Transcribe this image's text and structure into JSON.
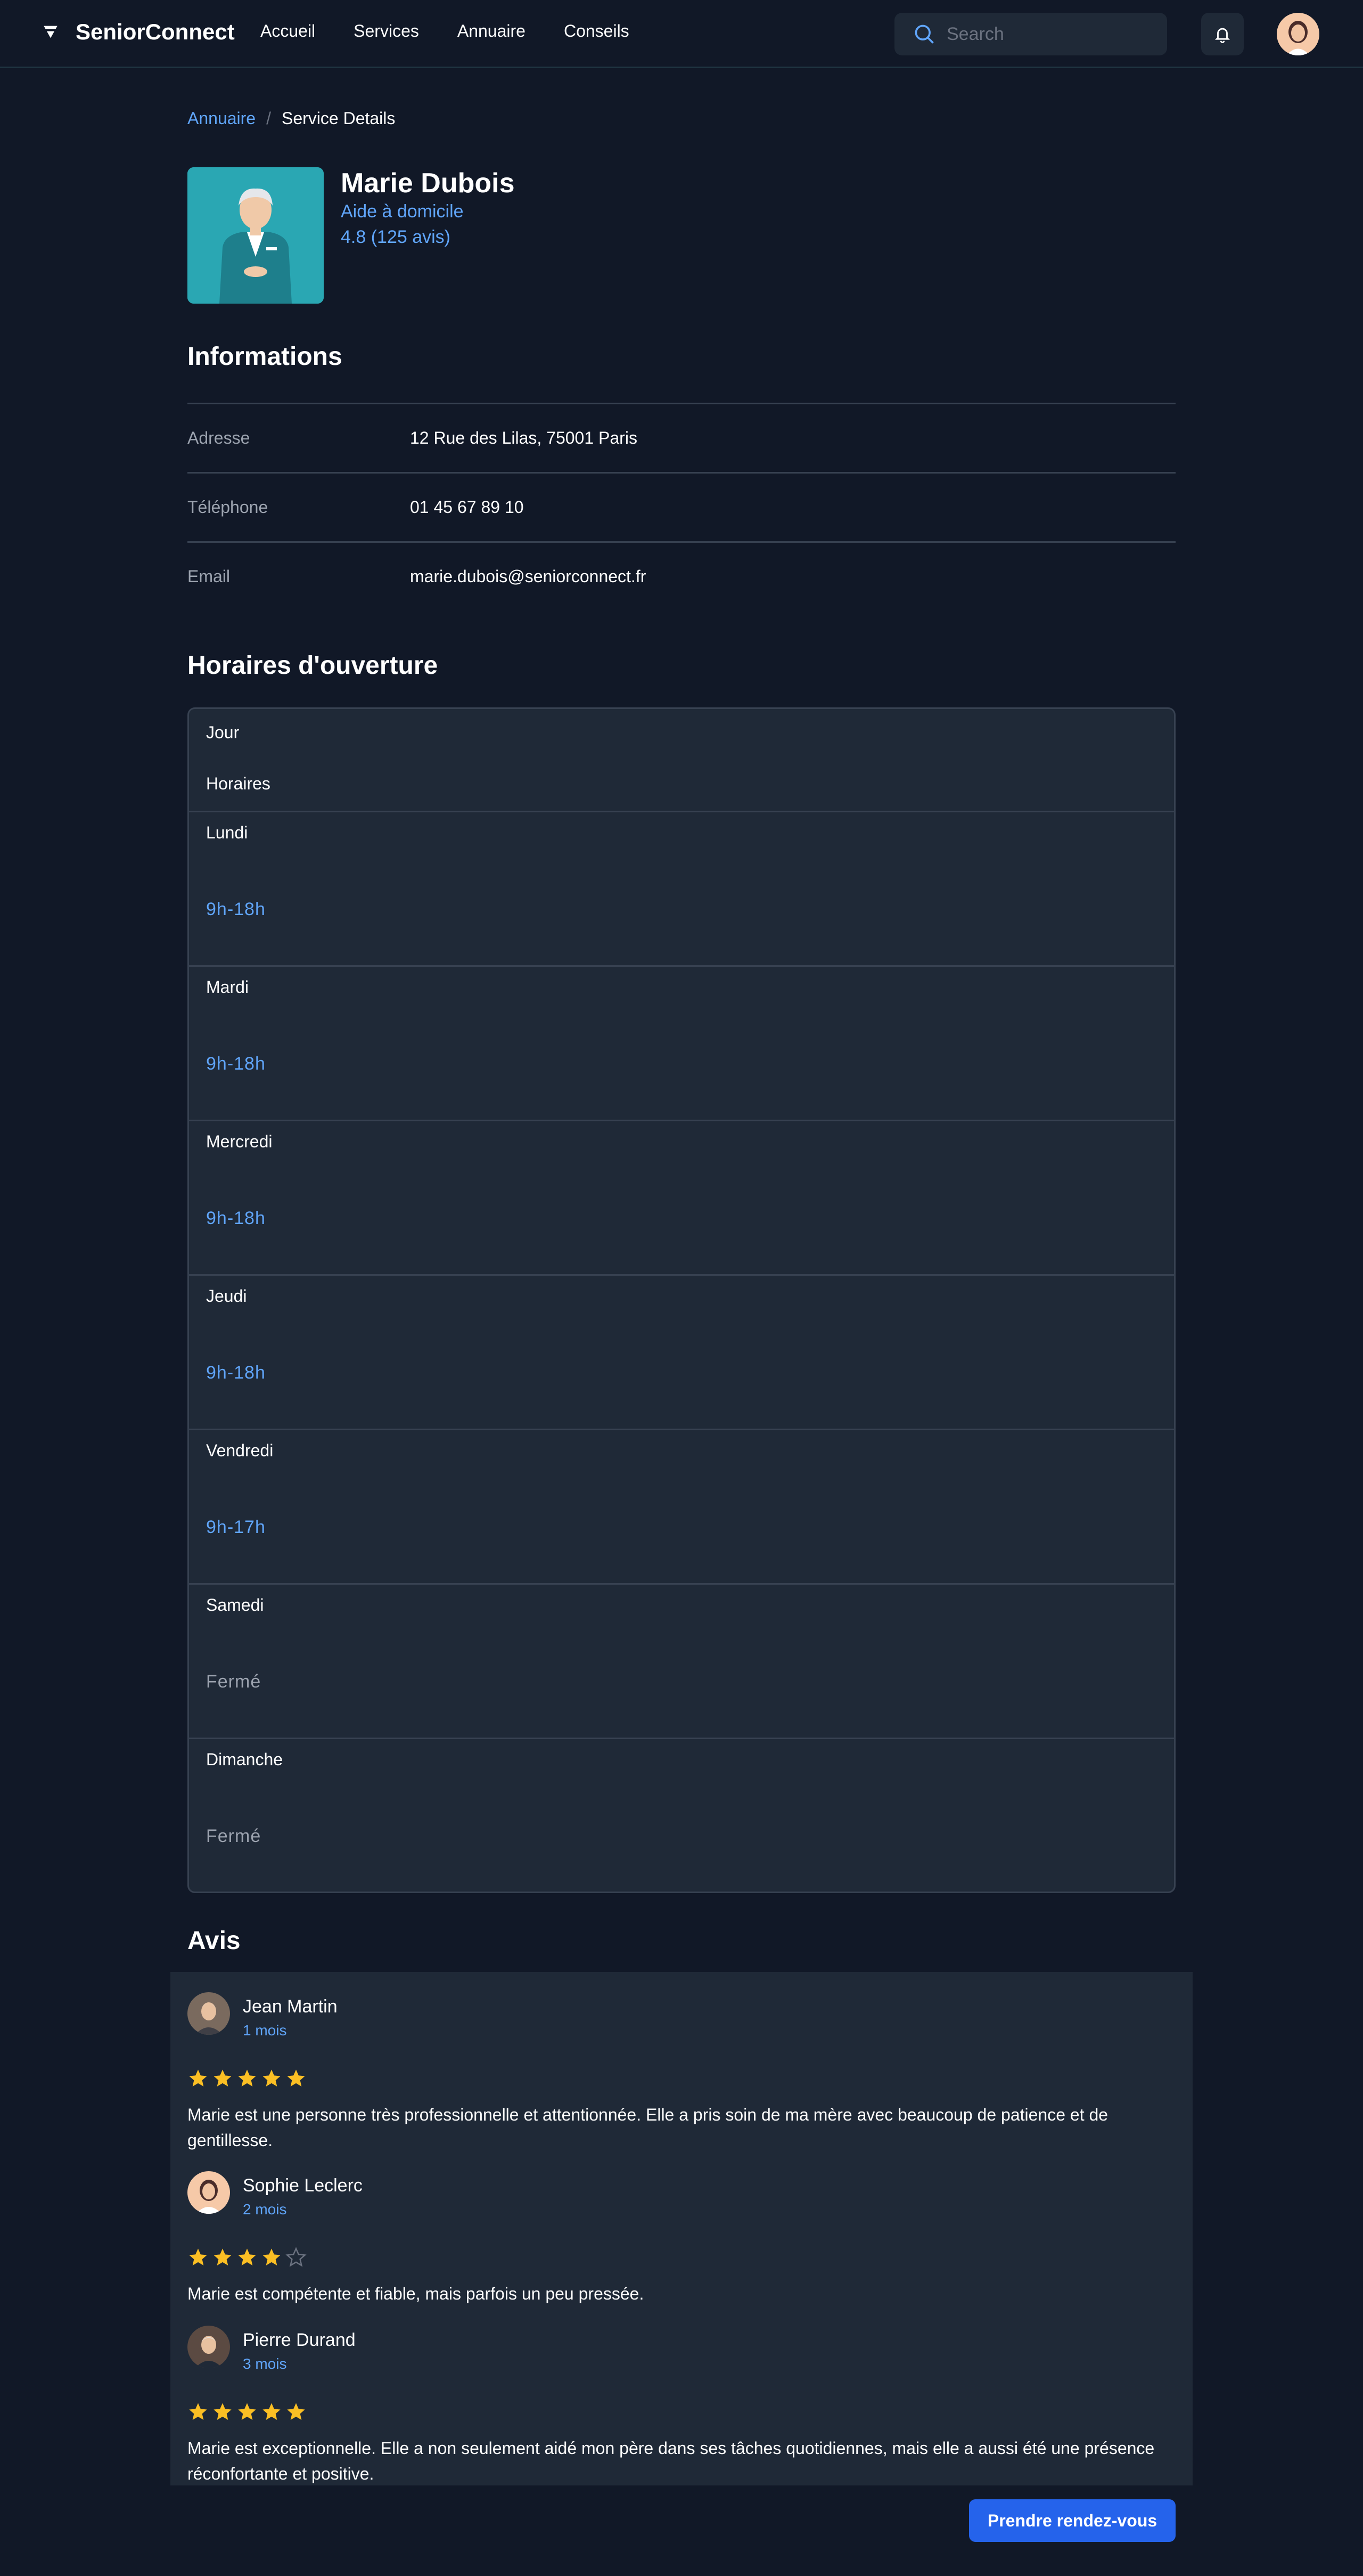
{
  "header": {
    "brand": "SeniorConnect",
    "nav": [
      "Accueil",
      "Services",
      "Annuaire",
      "Conseils"
    ],
    "search_placeholder": "Search"
  },
  "breadcrumb": {
    "parent": "Annuaire",
    "separator": "/",
    "current": "Service Details"
  },
  "profile": {
    "name": "Marie Dubois",
    "role": "Aide à domicile",
    "rating": "4.8 (125 avis)"
  },
  "info": {
    "title": "Informations",
    "rows": [
      {
        "label": "Adresse",
        "value": "12 Rue des Lilas, 75001 Paris"
      },
      {
        "label": "Téléphone",
        "value": "01 45 67 89 10"
      },
      {
        "label": "Email",
        "value": "marie.dubois@seniorconnect.fr"
      }
    ]
  },
  "hours": {
    "title": "Horaires d'ouverture",
    "col_day": "Jour",
    "col_hours": "Horaires",
    "rows": [
      {
        "day": "Lundi",
        "hours": "9h-18h"
      },
      {
        "day": "Mardi",
        "hours": "9h-18h"
      },
      {
        "day": "Mercredi",
        "hours": "9h-18h"
      },
      {
        "day": "Jeudi",
        "hours": "9h-18h"
      },
      {
        "day": "Vendredi",
        "hours": "9h-17h"
      },
      {
        "day": "Samedi",
        "hours": "Fermé"
      },
      {
        "day": "Dimanche",
        "hours": "Fermé"
      }
    ]
  },
  "reviews": {
    "title": "Avis",
    "items": [
      {
        "name": "Jean Martin",
        "time": "1 mois",
        "rating": 5,
        "text": "Marie est une personne très professionnelle et attentionnée. Elle a pris soin de ma mère avec beaucoup de patience et de gentillesse."
      },
      {
        "name": "Sophie Leclerc",
        "time": "2 mois",
        "rating": 4,
        "text": "Marie est compétente et fiable, mais parfois un peu pressée."
      },
      {
        "name": "Pierre Durand",
        "time": "3 mois",
        "rating": 5,
        "text": "Marie est exceptionnelle. Elle a non seulement aidé mon père dans ses tâches quotidiennes, mais elle a aussi été une présence réconfortante et positive."
      }
    ]
  },
  "cta": {
    "label": "Prendre rendez-vous"
  },
  "colors": {
    "background": "#111827",
    "surface": "#1f2937",
    "accent": "#60a5fa",
    "button": "#2563eb",
    "star": "#fbbf24"
  }
}
